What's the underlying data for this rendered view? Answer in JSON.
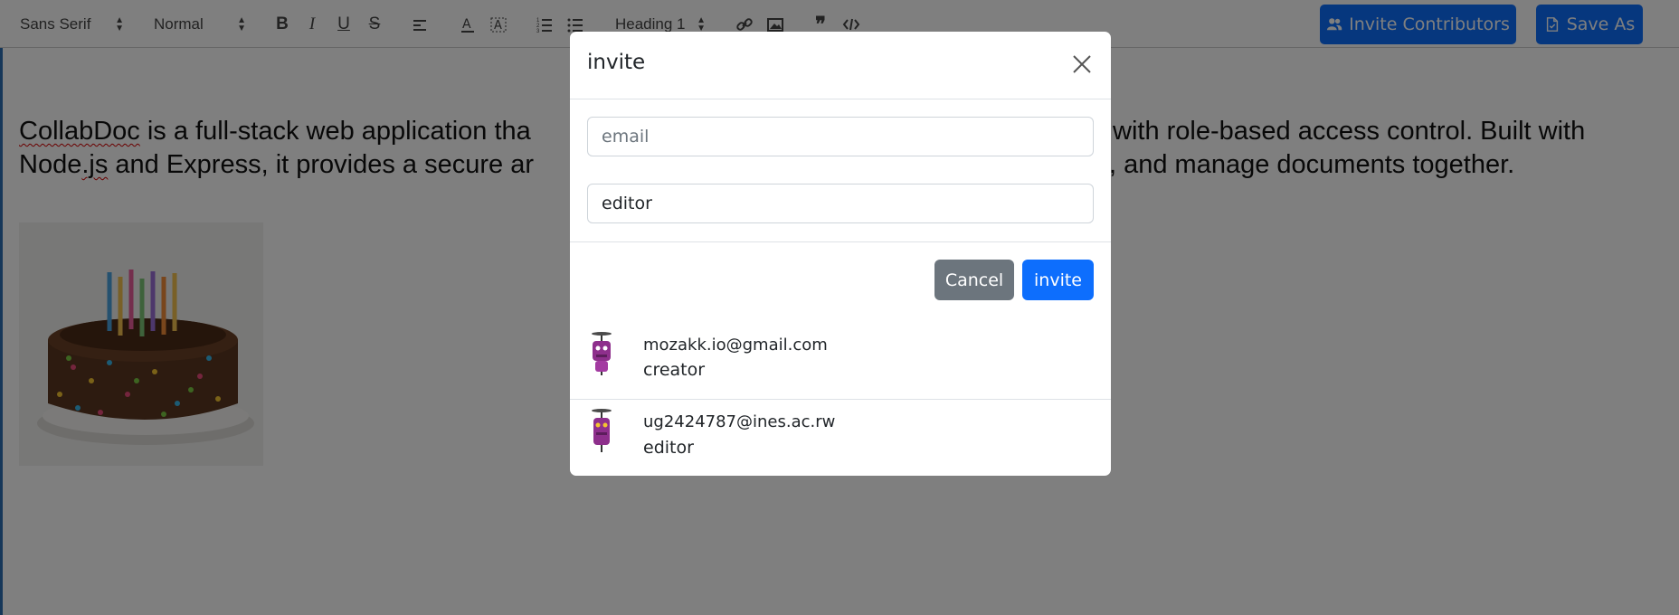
{
  "toolbar": {
    "font_family": "Sans Serif",
    "font_size": "Normal",
    "heading": "Heading 1",
    "invite_contributors_label": "Invite Contributors",
    "save_as_label": "Save As"
  },
  "document": {
    "word_collabdoc": "CollabDoc",
    "line1_rest": " is a full-stack web application tha",
    "line1_right": "with role-based access control. Built with",
    "line2_part1": "Node",
    "line2_js": ".js",
    "line2_mid": " and Express, it provides a secure ar",
    "line2_right": ", and manage documents together."
  },
  "modal": {
    "title": "invite",
    "email_placeholder": "email",
    "role_value": "editor",
    "cancel_label": "Cancel",
    "invite_label": "invite",
    "contributors": [
      {
        "email": "mozakk.io@gmail.com",
        "role": "creator"
      },
      {
        "email": "ug2424787@ines.ac.rw",
        "role": "editor"
      }
    ]
  },
  "colors": {
    "primary": "#0d6efd",
    "secondary": "#6c757d",
    "backdrop": "rgba(0,0,0,0.5)"
  }
}
